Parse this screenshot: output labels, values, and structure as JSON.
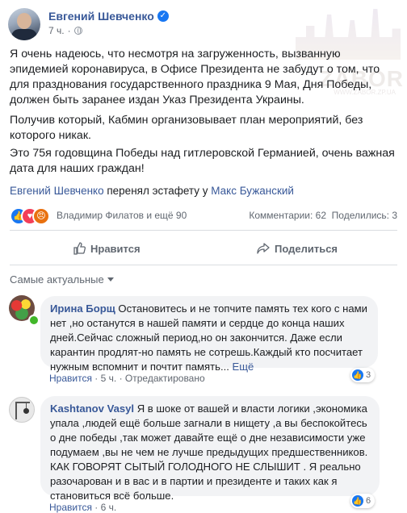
{
  "post": {
    "author": "Евгений Шевченко",
    "time": "7 ч.",
    "watermark_text": "ZABOR",
    "watermark_url": "WWW.ZABOR.ZP.UA",
    "paragraph1": "Я очень надеюсь, что несмотря на загруженность, вызванную эпидемией коронавируса, в Офисе Президента не забудут о том, что для празднования государственного праздника 9 Мая, Дня Победы, должен быть заранее издан Указ Президента Украины.",
    "paragraph2": "Получив который, Кабмин организовывает план мероприятий, без которого никак.",
    "paragraph3": "Это 75я годовщина Победы над гитлеровской Германией, очень важная дата для наших граждан!",
    "relay": {
      "from": "Евгений Шевченко",
      "middle": " перенял эстафету у ",
      "to": "Макс Бужанский"
    },
    "reactions": {
      "summary": "Владимир Филатов и ещё 90",
      "comments": "Комментарии: 62",
      "shares": "Поделились: 3"
    },
    "actions": {
      "like": "Нравится",
      "share": "Поделиться"
    }
  },
  "comments": {
    "sort_label": "Самые актуальные",
    "items": [
      {
        "name": "Ирина Борщ",
        "text": " Остановитесь и не топчите память тех кого с нами нет ,но останутся в нашей памяти и сердце до конца наших дней.Сейчас сложный период,но он закончится. Даже если карантин продлят-но память не сотрешь.Каждый кто посчитает нужным вспомнит и почтит память... ",
        "more": "Ещё",
        "like": "Нравится",
        "time": "5 ч.",
        "edited": "Отредактировано",
        "reaction_count": "3"
      },
      {
        "name": "Kashtanov Vasyl",
        "text": " Я в шоке от вашей и власти логики ,экономика упала ,людей ещё больше загнали в нищету ,а вы беспокойтесь о дне победы ,так может давайте ещё о дне независимости уже подумаем ,вы не чем не лучше предыдущих предшественников. КАК ГОВОРЯТ СЫТЫЙ ГОЛОДНОГО НЕ СЛЫШИТ . Я реально разочарован и в вас и в партии и президенте и таких как я становиться всё больше.",
        "like": "Нравится",
        "time": "6 ч.",
        "reaction_count": "6"
      }
    ]
  },
  "colors": {
    "link": "#385898",
    "like_blue": "#1877f2",
    "meta_gray": "#616770",
    "bubble_bg": "#f2f3f5"
  },
  "icons": [
    "verified-icon",
    "globe-icon",
    "like-reaction-icon",
    "love-reaction-icon",
    "angry-reaction-icon",
    "thumbs-up-icon",
    "share-icon",
    "chevron-down-icon"
  ]
}
